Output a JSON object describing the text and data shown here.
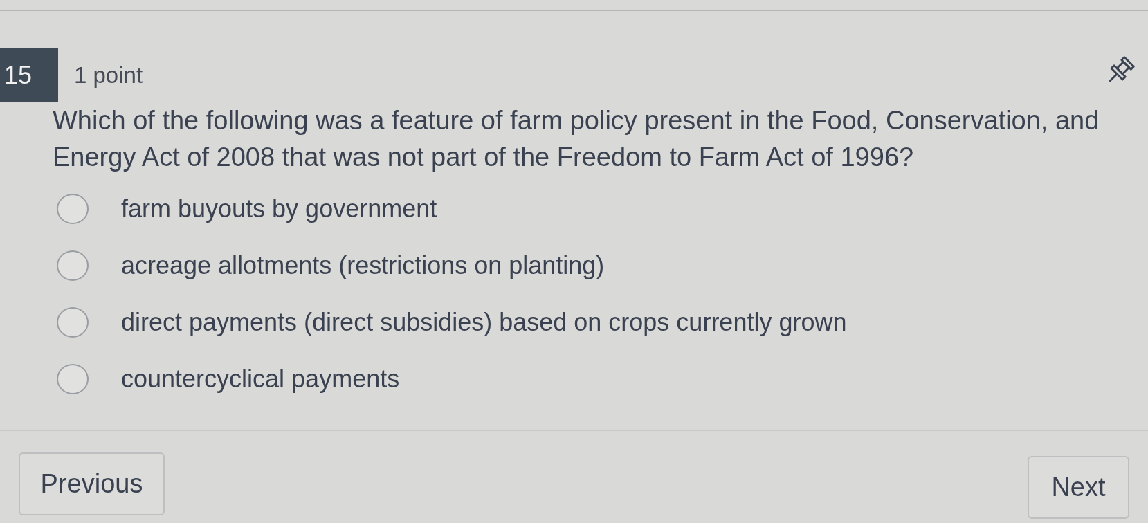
{
  "question": {
    "number": "15",
    "points": "1 point",
    "text": "Which of the following was a feature of farm policy present in the Food, Conservation, and Energy Act of 2008 that was not part of the Freedom to Farm Act of 1996?"
  },
  "options": [
    {
      "label": "farm buyouts by government",
      "selected": false
    },
    {
      "label": "acreage allotments (restrictions on planting)",
      "selected": false
    },
    {
      "label": "direct payments (direct subsidies) based on crops currently grown",
      "selected": false
    },
    {
      "label": "countercyclical payments",
      "selected": false
    }
  ],
  "navigation": {
    "previous": "Previous",
    "next": "Next"
  }
}
